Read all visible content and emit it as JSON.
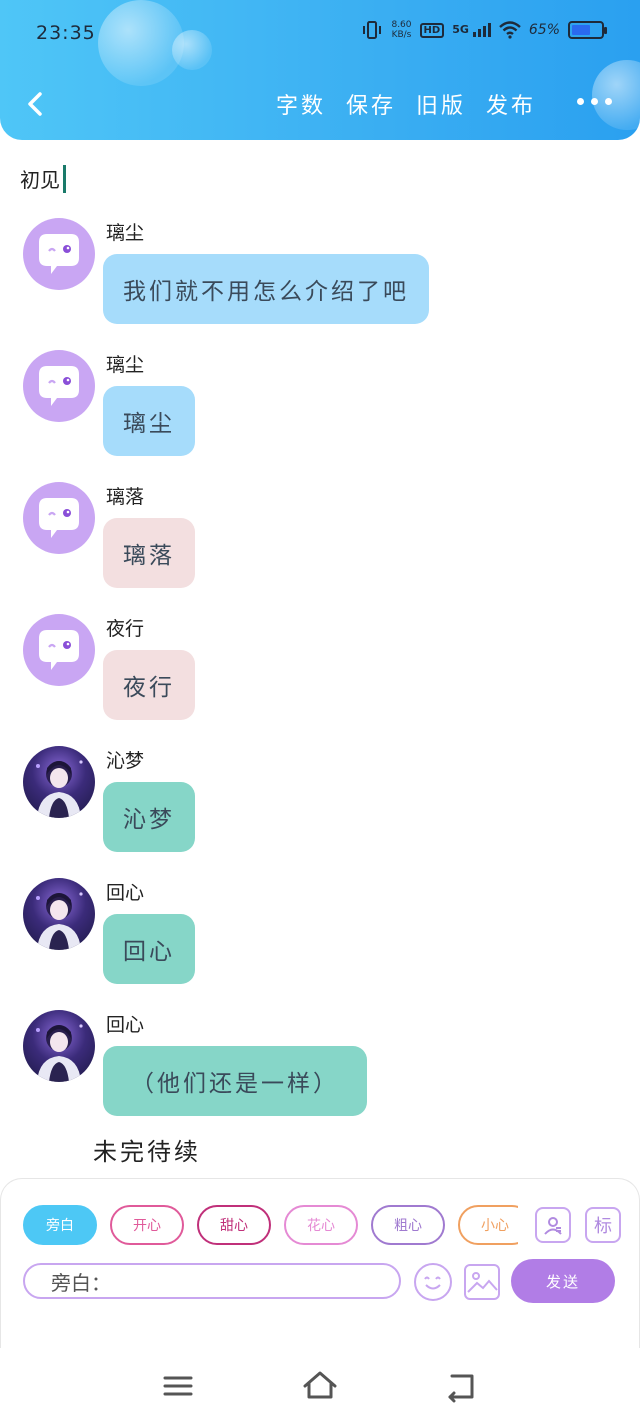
{
  "status_bar": {
    "time": "23:35",
    "net_speed_value": "8.60",
    "net_speed_unit": "KB/s",
    "hd": "HD",
    "network": "5G",
    "battery_percent": "65%",
    "battery_level": 0.65
  },
  "header": {
    "actions": [
      {
        "label": "字数"
      },
      {
        "label": "保存"
      },
      {
        "label": "旧版"
      },
      {
        "label": "发布"
      }
    ]
  },
  "chapter_title": "初见",
  "messages": [
    {
      "sender": "璃尘",
      "text": "我们就不用怎么介绍了吧",
      "bubble": "blue",
      "avatar": "default"
    },
    {
      "sender": "璃尘",
      "text": "璃尘",
      "bubble": "blue",
      "avatar": "default"
    },
    {
      "sender": "璃落",
      "text": "璃落",
      "bubble": "pink",
      "avatar": "default"
    },
    {
      "sender": "夜行",
      "text": "夜行",
      "bubble": "pink",
      "avatar": "default"
    },
    {
      "sender": "沁梦",
      "text": "沁梦",
      "bubble": "teal",
      "avatar": "photo"
    },
    {
      "sender": "回心",
      "text": "回心",
      "bubble": "teal",
      "avatar": "photo"
    },
    {
      "sender": "回心",
      "text": "（他们还是一样）",
      "bubble": "teal",
      "avatar": "photo"
    }
  ],
  "footer_note": "未完待续",
  "toolbar": {
    "chips": [
      {
        "label": "旁白",
        "style": "active"
      },
      {
        "label": "开心",
        "style": "c1"
      },
      {
        "label": "甜心",
        "style": "c2"
      },
      {
        "label": "花心",
        "style": "c3"
      },
      {
        "label": "粗心",
        "style": "c4"
      },
      {
        "label": "小心",
        "style": "c5"
      }
    ],
    "tag_icon_label": "标",
    "input_value": "旁白：",
    "send_label": "发送"
  },
  "icons": {
    "back": "chevron-left-icon",
    "more": "more-dots-icon",
    "avatar_default": "chat-bubble-face-icon",
    "character": "person-card-icon",
    "tag": "tag-icon",
    "emoji": "smiley-icon",
    "image": "image-icon",
    "menu": "menu-icon",
    "home": "home-icon",
    "return": "return-icon"
  }
}
